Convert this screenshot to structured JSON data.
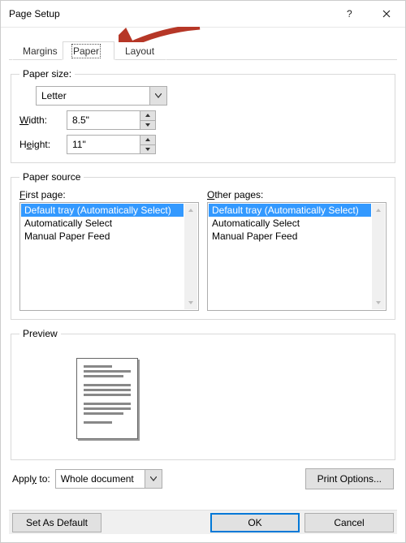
{
  "dialog": {
    "title": "Page Setup"
  },
  "tabs": {
    "margins": "Margins",
    "paper": "Paper",
    "layout": "Layout"
  },
  "paper_size": {
    "legend": "Paper size:",
    "selected": "Letter",
    "width_label_pre": "",
    "width_label_ul": "W",
    "width_label_post": "idth:",
    "width_value": "8.5\"",
    "height_label_pre": "H",
    "height_label_ul": "e",
    "height_label_post": "ight:",
    "height_value": "11\""
  },
  "paper_source": {
    "legend": "Paper source",
    "first_page_label_ul": "F",
    "first_page_label_post": "irst page:",
    "other_pages_label_ul": "O",
    "other_pages_label_post": "ther pages:",
    "options": [
      "Default tray (Automatically Select)",
      "Automatically Select",
      "Manual Paper Feed"
    ],
    "first_page_selected": "Default tray (Automatically Select)",
    "other_pages_selected": "Default tray (Automatically Select)"
  },
  "preview": {
    "legend": "Preview"
  },
  "apply": {
    "label_pre": "Appl",
    "label_ul": "y",
    "label_post": " to:",
    "selected": "Whole document"
  },
  "buttons": {
    "print_options": "Print Options...",
    "set_as_default": "Set As Default",
    "ok": "OK",
    "cancel": "Cancel"
  }
}
